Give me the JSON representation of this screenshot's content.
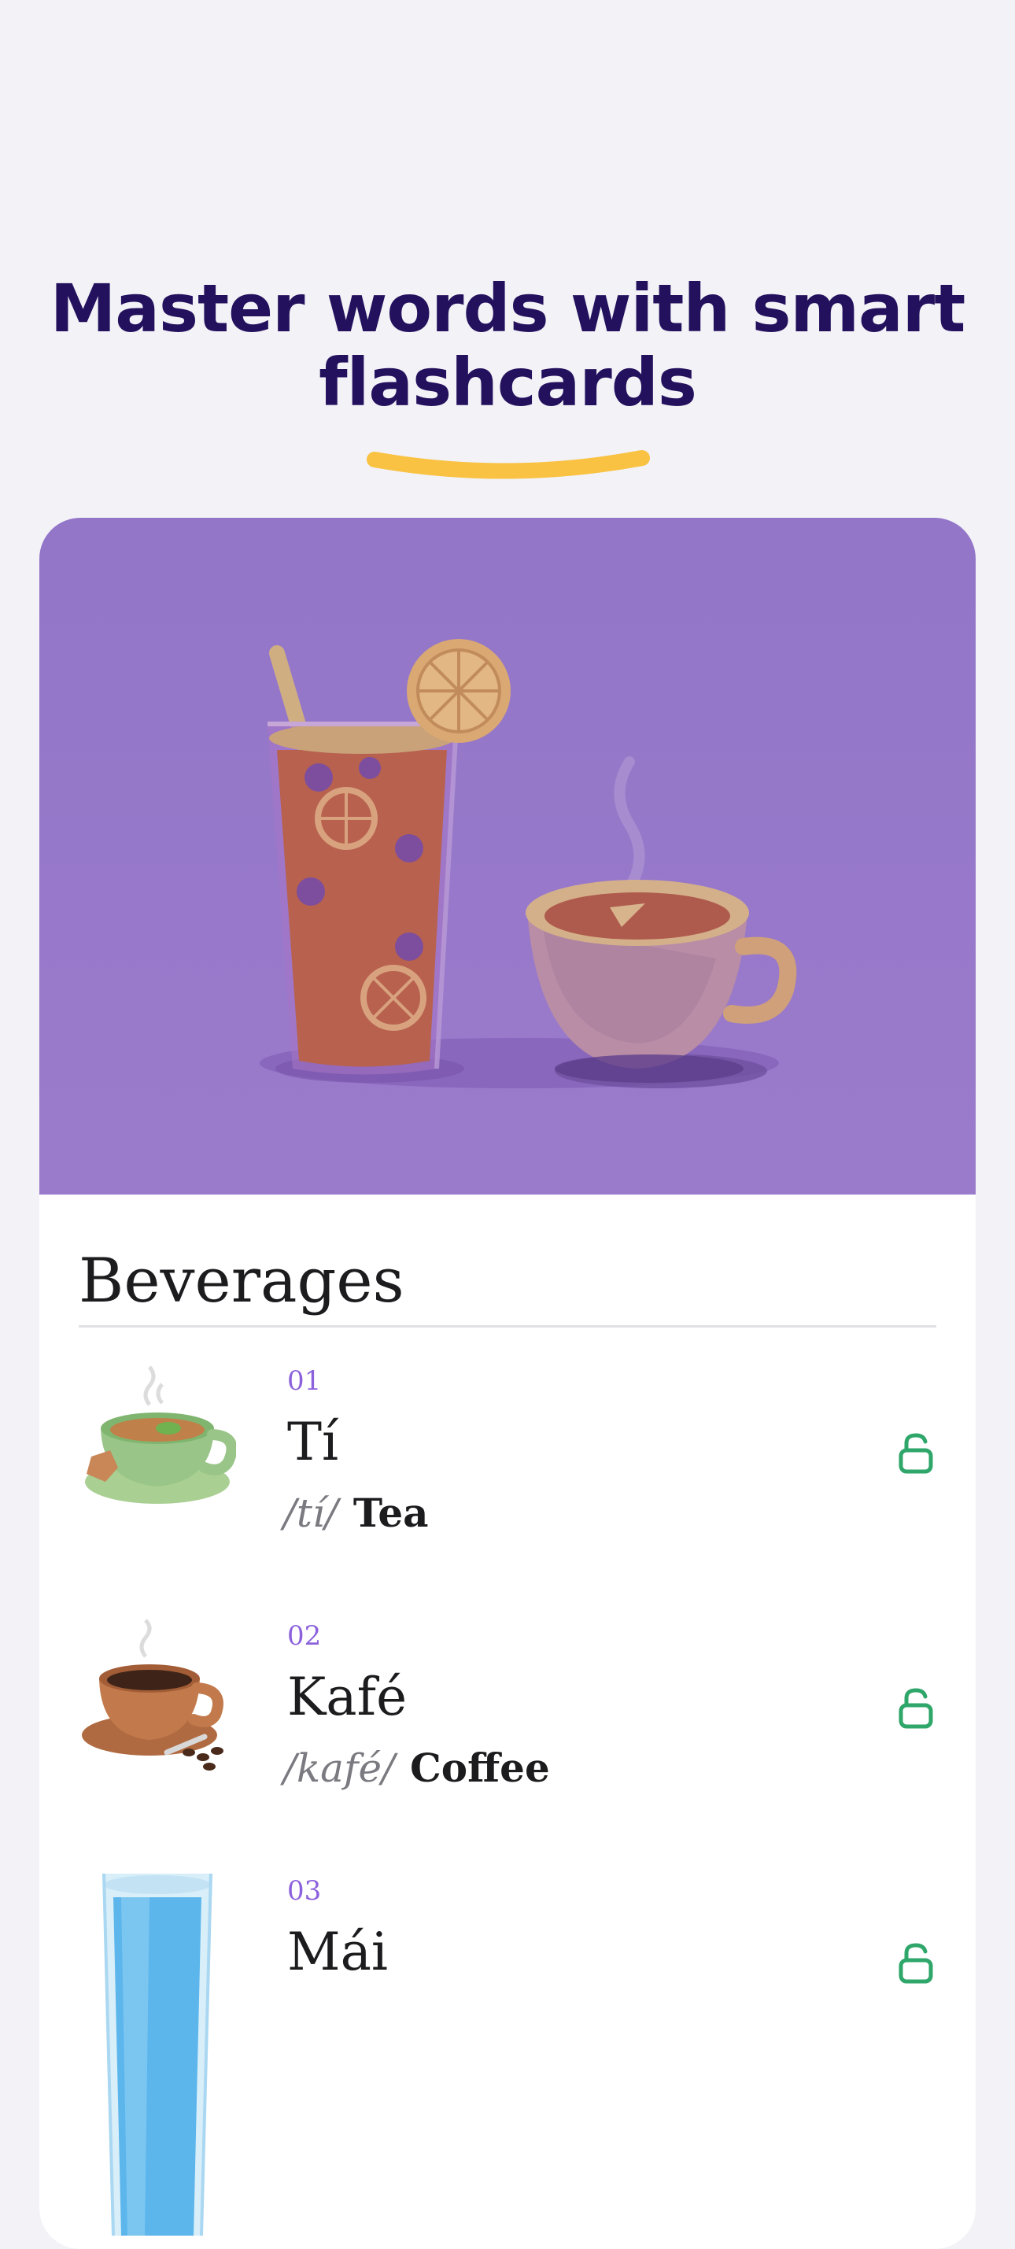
{
  "headline": {
    "line1": "Master words with smart",
    "line2": "flashcards"
  },
  "card": {
    "section_title": "Beverages",
    "words": [
      {
        "index": "01",
        "term": "Tí",
        "phonetic": "/tí/",
        "translation": "Tea",
        "thumbnail_icon": "tea-cup-icon",
        "unlocked": true
      },
      {
        "index": "02",
        "term": "Kafé",
        "phonetic": "/kafé/",
        "translation": "Coffee",
        "thumbnail_icon": "coffee-cup-icon",
        "unlocked": true
      },
      {
        "index": "03",
        "term": "Mái",
        "phonetic": "",
        "translation": "",
        "thumbnail_icon": "water-glass-icon",
        "unlocked": true
      }
    ]
  },
  "colors": {
    "headline": "#24115e",
    "accent_underline": "#f9c243",
    "hero_background": "#9376c8",
    "index_number": "#8c62dc",
    "unlocked_icon": "#2fa66a"
  }
}
